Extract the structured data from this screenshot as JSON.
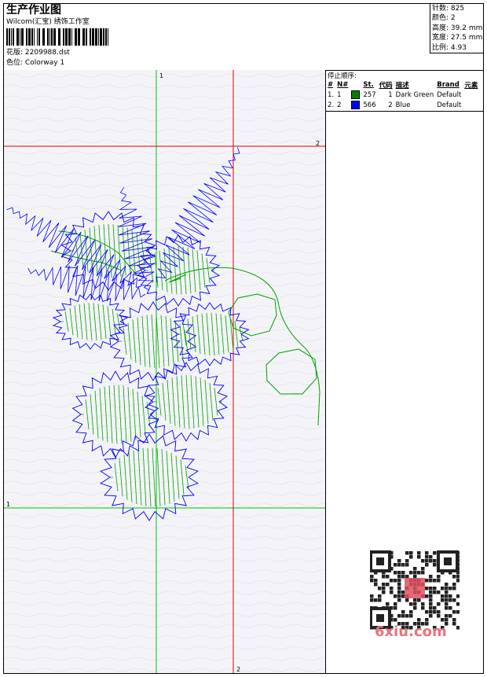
{
  "header": {
    "title": "生产作业图",
    "company": "Wilcom(汇宝) 绣饰工作室",
    "design_label": "花版:",
    "design_file": "2209988.dst",
    "colorway_label": "色位:",
    "colorway": "Colorway 1"
  },
  "stats": [
    {
      "label": "针数:",
      "value": "825"
    },
    {
      "label": "颜色:",
      "value": "2"
    },
    {
      "label": "高度:",
      "value": "39.2 mm"
    },
    {
      "label": "宽度:",
      "value": "27.5 mm"
    },
    {
      "label": "比例:",
      "value": "4.93"
    }
  ],
  "stop_sequence": {
    "title": "停止顺序:",
    "columns": [
      "#",
      "N#",
      "St.",
      "代码",
      "描述",
      "Brand",
      "元素"
    ],
    "rows": [
      {
        "idx": "1.",
        "n": "1",
        "color": "#008000",
        "st": "257",
        "code": "1",
        "desc": "Dark Green",
        "brand": "Default"
      },
      {
        "idx": "2.",
        "n": "2",
        "color": "#0000ff",
        "st": "566",
        "code": "2",
        "desc": "Blue",
        "brand": "Default"
      }
    ]
  },
  "guides": {
    "green_v_label": "1",
    "green_h_label": "1",
    "red_h_label": "2",
    "red_v_label": "2"
  },
  "colors": {
    "green_guide": "#00c000",
    "red_guide": "#e00000",
    "thread_green": "#00a000",
    "thread_blue": "#0000ff"
  },
  "watermark": {
    "text": "6xiu.com"
  }
}
